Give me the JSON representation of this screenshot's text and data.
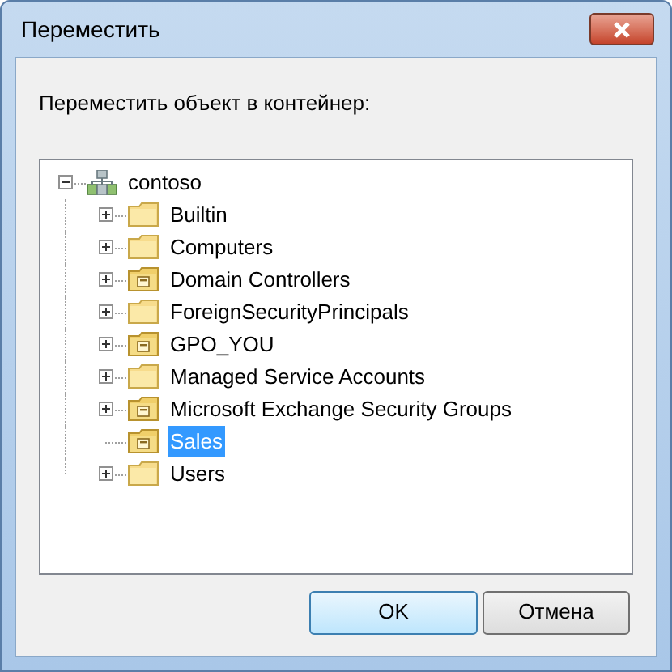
{
  "window": {
    "title": "Переместить"
  },
  "prompt": "Переместить объект в контейнер:",
  "tree": {
    "label": "contoso",
    "kind": "domain",
    "expandable": true,
    "expanded": true,
    "selected": false,
    "children": [
      {
        "label": "Builtin",
        "kind": "folder",
        "expandable": true,
        "selected": false
      },
      {
        "label": "Computers",
        "kind": "folder",
        "expandable": true,
        "selected": false
      },
      {
        "label": "Domain Controllers",
        "kind": "ou",
        "expandable": true,
        "selected": false
      },
      {
        "label": "ForeignSecurityPrincipals",
        "kind": "folder",
        "expandable": true,
        "selected": false
      },
      {
        "label": "GPO_YOU",
        "kind": "ou",
        "expandable": true,
        "selected": false
      },
      {
        "label": "Managed Service Accounts",
        "kind": "folder",
        "expandable": true,
        "selected": false
      },
      {
        "label": "Microsoft Exchange Security Groups",
        "kind": "ou",
        "expandable": true,
        "selected": false
      },
      {
        "label": "Sales",
        "kind": "ou",
        "expandable": false,
        "selected": true
      },
      {
        "label": "Users",
        "kind": "folder",
        "expandable": true,
        "selected": false
      }
    ]
  },
  "buttons": [
    {
      "label": "OK",
      "default": true
    },
    {
      "label": "Отмена",
      "default": false
    }
  ]
}
